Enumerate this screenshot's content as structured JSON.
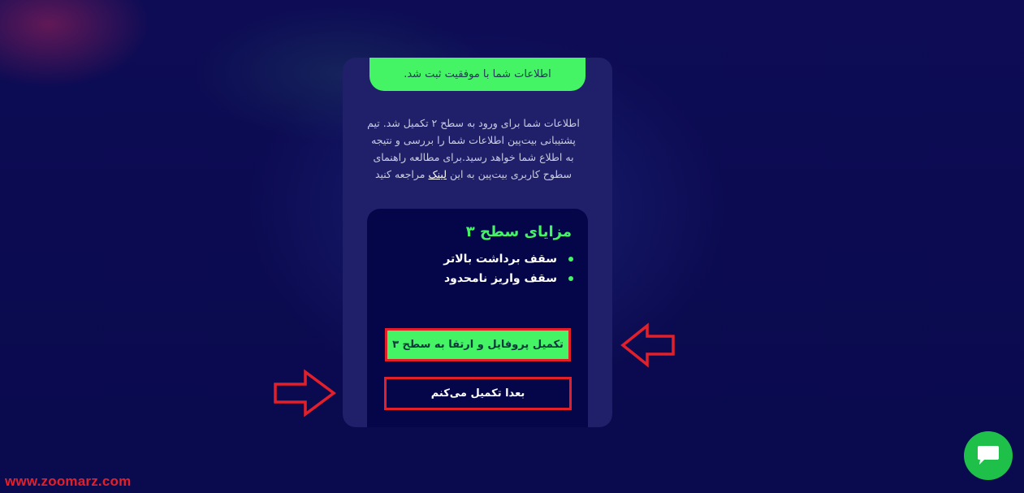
{
  "banner": {
    "success_text": "اطلاعات شما با موفقیت ثبت شد."
  },
  "description": {
    "text_before_link": "اطلاعات شما برای ورود به سطح ۲ تکمیل شد. تیم پشتیبانی بیت‌پین اطلاعات شما را بررسی و نتیجه به اطلاع شما خواهد رسید.برای مطالعه راهنمای سطوح کاربری بیت‌پین به این ",
    "link_text": "لینک",
    "text_after_link": " مراجعه کنید"
  },
  "benefits": {
    "title": "مزایای سطح ۳",
    "items": [
      "سقف برداشت بالاتر",
      "سقف واریز نامحدود"
    ]
  },
  "actions": {
    "upgrade_label": "تکمیل پروفایل و ارتقا به سطح ۳",
    "later_label": "بعدا تکمیل می‌کنم"
  },
  "watermark": "www.zoomarz.com",
  "icons": {
    "chat": "chat-bubble-icon",
    "arrow_left": "arrow-left-icon",
    "arrow_right": "arrow-right-icon"
  },
  "colors": {
    "accent_green": "#44f465",
    "highlight_red": "#e3202a",
    "card_bg": "#1f2069",
    "inner_bg": "#05064a"
  }
}
